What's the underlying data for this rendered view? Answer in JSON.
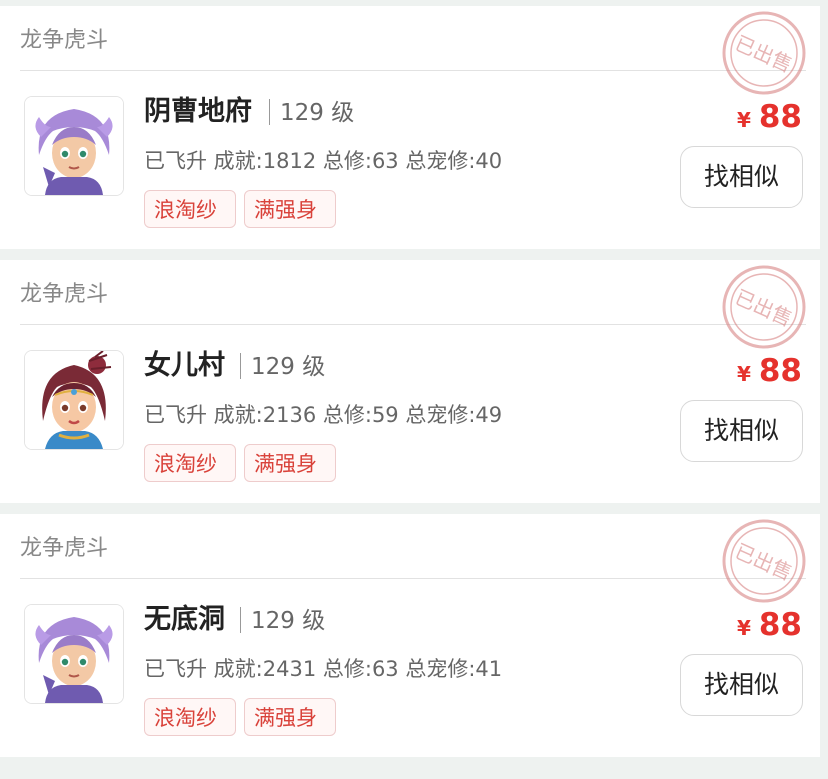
{
  "listings": [
    {
      "server": "龙争虎斗",
      "school": "阴曹地府",
      "level": "129 级",
      "stats": "已飞升 成就:1812 总修:63 总宠修:40",
      "tags": [
        "浪淘纱",
        "满强身"
      ],
      "currency": "¥",
      "price": "88",
      "button_label": "找相似",
      "stamp_text": "已出售",
      "avatar": "purple-haired-character-avatar"
    },
    {
      "server": "龙争虎斗",
      "school": "女儿村",
      "level": "129 级",
      "stats": "已飞升 成就:2136 总修:59 总宠修:49",
      "tags": [
        "浪淘纱",
        "满强身"
      ],
      "currency": "¥",
      "price": "88",
      "button_label": "找相似",
      "stamp_text": "已出售",
      "avatar": "red-haired-girl-avatar"
    },
    {
      "server": "龙争虎斗",
      "school": "无底洞",
      "level": "129 级",
      "stats": "已飞升 成就:2431 总修:63 总宠修:41",
      "tags": [
        "浪淘纱",
        "满强身"
      ],
      "currency": "¥",
      "price": "88",
      "button_label": "找相似",
      "stamp_text": "已出售",
      "avatar": "purple-haired-character-avatar"
    }
  ],
  "colors": {
    "price": "#e5322d",
    "tag_text": "#d9423a",
    "tag_border": "#eecccc",
    "stamp": "#d47a7a",
    "page_background": "#eef2f0"
  }
}
